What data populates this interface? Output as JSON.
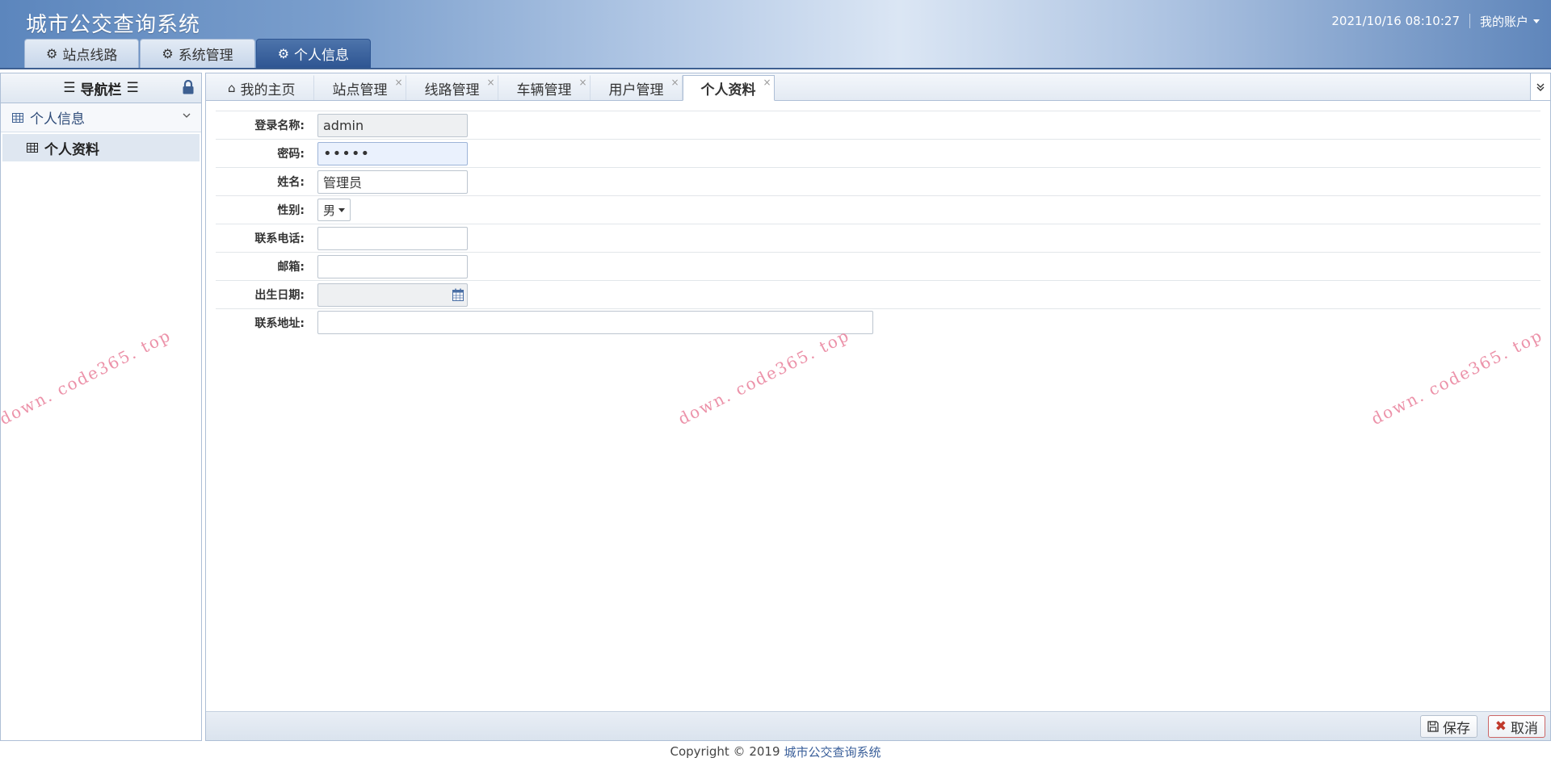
{
  "app": {
    "title": "城市公交查询系统"
  },
  "header": {
    "datetime": "2021/10/16 08:10:27",
    "account_label": "我的账户",
    "menu": [
      {
        "label": "站点线路",
        "icon": "gear-icon"
      },
      {
        "label": "系统管理",
        "icon": "gear-icon"
      },
      {
        "label": "个人信息",
        "icon": "gear-icon",
        "active": true
      }
    ]
  },
  "sidebar": {
    "title": "导航栏",
    "group_label": "个人信息",
    "item_label": "个人资料"
  },
  "tabs": [
    {
      "label": "我的主页",
      "icon": "home-icon",
      "closable": false
    },
    {
      "label": "站点管理",
      "closable": true
    },
    {
      "label": "线路管理",
      "closable": true
    },
    {
      "label": "车辆管理",
      "closable": true
    },
    {
      "label": "用户管理",
      "closable": true
    },
    {
      "label": "个人资料",
      "closable": true,
      "active": true
    }
  ],
  "close_glyph": "×",
  "form": {
    "login_name": {
      "label": "登录名称:",
      "value": "admin"
    },
    "password": {
      "label": "密码:",
      "value": "•••••"
    },
    "name": {
      "label": "姓名:",
      "value": "管理员"
    },
    "gender": {
      "label": "性别:",
      "value": "男"
    },
    "phone": {
      "label": "联系电话:",
      "value": ""
    },
    "email": {
      "label": "邮箱:",
      "value": ""
    },
    "birthdate": {
      "label": "出生日期:",
      "value": ""
    },
    "address": {
      "label": "联系地址:",
      "value": ""
    }
  },
  "buttons": {
    "save": "保存",
    "cancel": "取消"
  },
  "footer": {
    "copyright": "Copyright © 2019",
    "link": "城市公交查询系统"
  },
  "watermark": "down. code365. top",
  "colors": {
    "header_dark": "#2e5592",
    "accent": "#3a5f9a",
    "cancel": "#c0392b"
  }
}
